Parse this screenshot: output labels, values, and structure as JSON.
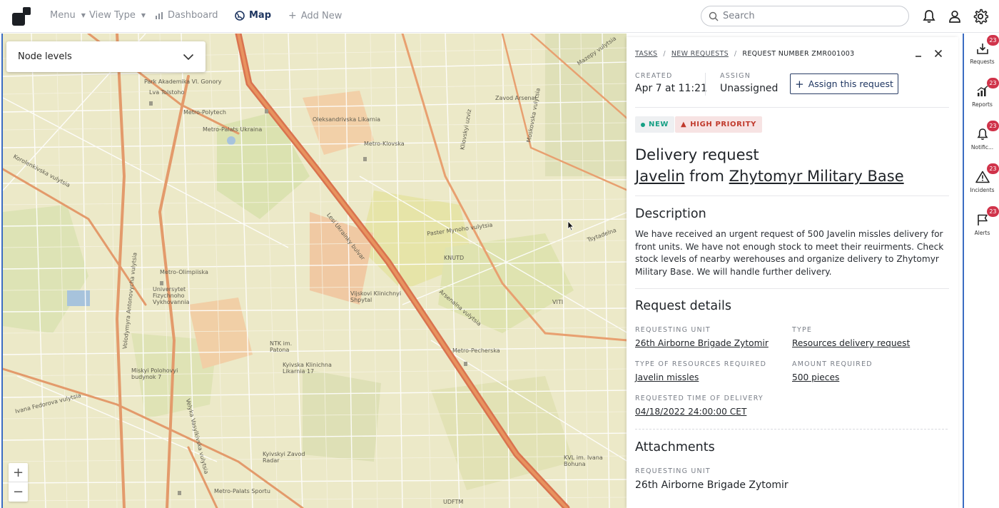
{
  "nav": {
    "menu": "Menu",
    "view_type": "View Type",
    "dashboard": "Dashboard",
    "map": "Map",
    "add_new": "Add New"
  },
  "search": {
    "placeholder": "Search"
  },
  "map": {
    "node_levels": "Node levels",
    "labels": [
      "Park Akademika Vl. Gonory",
      "Metro-Polytech",
      "Lva Tolstoho",
      "Metro-Palats Ukraina",
      "Oleksandrivska Likarnia",
      "Metro-Klovska",
      "Zavod Arsenal",
      "Metro-Olimpiiska",
      "Universytet Fizychnoho Vykhovannia",
      "Kliovskyi uzviz",
      "Paster Mynoho vulytsia",
      "KNUTD",
      "Vijskovi Klinichnyi Shpytal",
      "NTK im. Patona",
      "Kyivska Klinichna Likarnia 17",
      "Metro-Pecherska",
      "VITI",
      "Miskyi Polohovyi budynok 7",
      "Kyivskyi Zavod Radar",
      "Metro-Palats Sportu",
      "KVL im. Ivana Bohuna",
      "UDFTM",
      "Lesi Ukrainky bulvar",
      "Volodymyra Antonovycha vulytsia",
      "Ivana Fedorova vulytsia",
      "Velyka Vasylkivska vulytsia",
      "Moskovska vulytsia",
      "Tsytadelna",
      "Mazepy vulytsia",
      "Korolenkivska vulytsia",
      "Arsenalna vulytsia"
    ]
  },
  "panel": {
    "breadcrumb": {
      "tasks": "TASKS",
      "new_requests": "NEW REQUESTS",
      "current": "REQUEST NUMBER ZMR001003"
    },
    "created_label": "CREATED",
    "created_value": "Apr 7 at 11:21",
    "assign_label": "ASSIGN",
    "assign_value": "Unassigned",
    "assign_button": "Assign this request",
    "badge_new": "NEW",
    "badge_priority": "HIGH PRIORITY",
    "title_line1": "Delivery request",
    "title_item": "Javelin",
    "title_from": "from",
    "title_location": "Zhytomyr Military Base",
    "description_heading": "Description",
    "description": "We have received an urgent request of 500 Javelin missles delivery for front units. We have not enough stock to meet their reuirments. Check stock levels of nearby werehouses and organize delivery to Zhytomyr Military Base. We will handle further delivery.",
    "details_heading": "Request details",
    "requesting_unit_label": "REQUESTING UNIT",
    "requesting_unit": "26th Airborne Brigade Zytomir",
    "type_label": "TYPE",
    "type_value": "Resources delivery request",
    "resources_label": "TYPE OF RESOURCES REQUIRED",
    "resources_value": "Javelin missles",
    "amount_label": "AMOUNT REQUIRED",
    "amount_value": "500 pieces",
    "time_label": "REQUESTED TIME OF DELIVERY",
    "time_value": "04/18/2022 24:00:00 CET",
    "attachments_heading": "Attachments",
    "attach_unit_label": "REQUESTING UNIT",
    "attach_unit_value": "26th Airborne Brigade Zytomir"
  },
  "rightbar": [
    {
      "label": "Requests",
      "count": "23",
      "icon": "inbox-icon"
    },
    {
      "label": "Reports",
      "count": "23",
      "icon": "chart-icon"
    },
    {
      "label": "Notific...",
      "count": "23",
      "icon": "bell-icon"
    },
    {
      "label": "Incidents",
      "count": "23",
      "icon": "warning-icon"
    },
    {
      "label": "Alerts",
      "count": "23",
      "icon": "flag-icon"
    }
  ],
  "colors": {
    "accent": "#1e3560",
    "road_major": "#d9734f",
    "map_bg": "#ece9c8",
    "badge": "#d0334a",
    "new_green": "#16a085",
    "priority_red": "#c0392b"
  }
}
